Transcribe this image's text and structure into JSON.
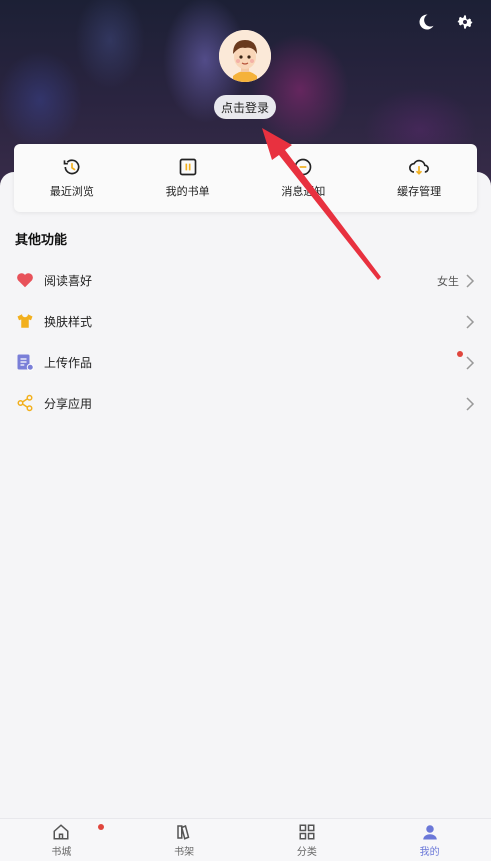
{
  "header": {
    "login_label": "点击登录"
  },
  "top_icons": [
    "moon-icon",
    "gear-icon"
  ],
  "quick_actions": [
    {
      "label": "最近浏览",
      "icon": "history-icon"
    },
    {
      "label": "我的书单",
      "icon": "booklist-icon"
    },
    {
      "label": "消息通知",
      "icon": "message-icon"
    },
    {
      "label": "缓存管理",
      "icon": "cloud-download-icon"
    }
  ],
  "section": {
    "title": "其他功能"
  },
  "menu": [
    {
      "label": "阅读喜好",
      "value": "女生",
      "icon": "heart-icon",
      "icon_color": "#e8525a"
    },
    {
      "label": "换肤样式",
      "value": "",
      "icon": "shirt-icon",
      "icon_color": "#f2b01e"
    },
    {
      "label": "上传作品",
      "value": "",
      "icon": "upload-doc-icon",
      "icon_color": "#7a7fd8",
      "badge": true
    },
    {
      "label": "分享应用",
      "value": "",
      "icon": "share-icon",
      "icon_color": "#f2b01e"
    }
  ],
  "tabbar": [
    {
      "label": "书城",
      "icon": "home-icon",
      "badge": true
    },
    {
      "label": "书架",
      "icon": "bookshelf-icon"
    },
    {
      "label": "分类",
      "icon": "category-icon"
    },
    {
      "label": "我的",
      "icon": "user-icon",
      "active": true
    }
  ],
  "colors": {
    "accent": "#6b78d8",
    "arrow": "#e8313f",
    "badge": "#e0463d"
  }
}
